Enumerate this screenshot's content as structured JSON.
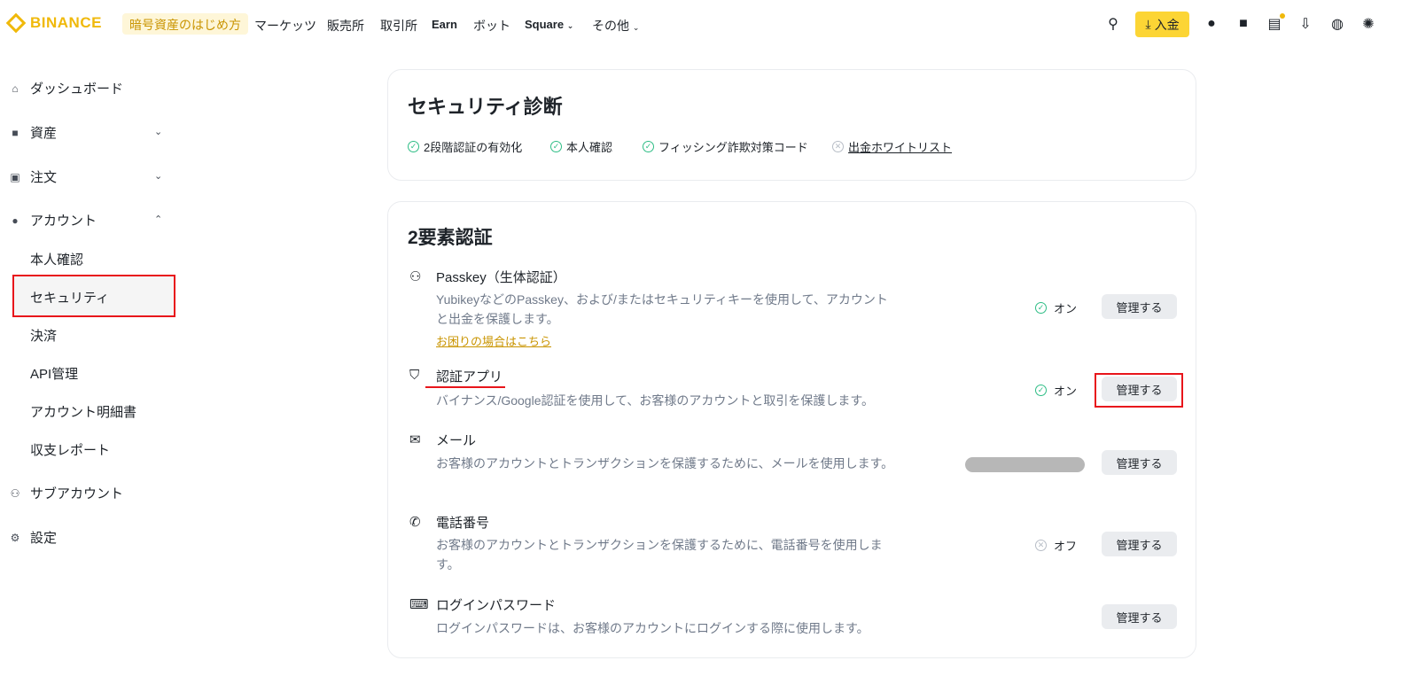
{
  "header": {
    "logo": "BINANCE",
    "guide": "暗号資産のはじめ方",
    "nav": [
      "マーケッツ",
      "販売所",
      "取引所",
      "Earn",
      "ボット",
      "Square",
      "その他"
    ],
    "deposit": "入金"
  },
  "sidebar": {
    "dashboard": "ダッシュボード",
    "assets": "資産",
    "orders": "注文",
    "account": "アカウント",
    "sub_items": [
      "本人確認",
      "セキュリティ",
      "決済",
      "API管理",
      "アカウント明細書",
      "収支レポート"
    ],
    "subaccount": "サブアカウント",
    "settings": "設定"
  },
  "diagnosis": {
    "title": "セキュリティ診断",
    "checks": [
      {
        "label": "2段階認証の有効化",
        "ok": true
      },
      {
        "label": "本人確認",
        "ok": true
      },
      {
        "label": "フィッシング詐欺対策コード",
        "ok": true
      },
      {
        "label": "出金ホワイトリスト",
        "ok": false
      }
    ]
  },
  "twofa": {
    "title": "2要素認証",
    "manage": "管理する",
    "rows": [
      {
        "title": "Passkey（生体認証）",
        "desc": "YubikeyなどのPasskey、および/またはセキュリティキーを使用して、アカウントと出金を保護します。",
        "link": "お困りの場合はこちら",
        "status": "オン"
      },
      {
        "title": "認証アプリ",
        "desc": "バイナンス/Google認証を使用して、お客様のアカウントと取引を保護します。",
        "status": "オン"
      },
      {
        "title": "メール",
        "desc": "お客様のアカウントとトランザクションを保護するために、メールを使用します。"
      },
      {
        "title": "電話番号",
        "desc": "お客様のアカウントとトランザクションを保護するために、電話番号を使用します。",
        "status": "オフ"
      },
      {
        "title": "ログインパスワード",
        "desc": "ログインパスワードは、お客様のアカウントにログインする際に使用します。"
      }
    ]
  }
}
